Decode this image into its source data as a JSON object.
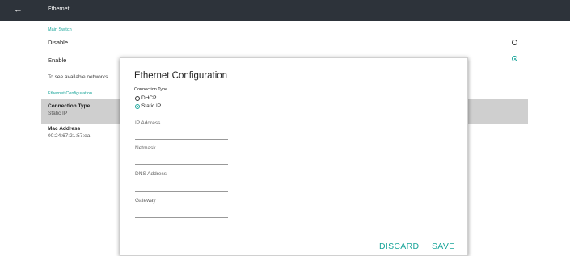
{
  "topbar": {
    "back_icon": "arrow-left-icon",
    "title": "Ethernet"
  },
  "settings": {
    "main_switch": {
      "section_label": "Main Switch",
      "options": [
        {
          "label": "Disable",
          "selected": false
        },
        {
          "label": "Enable",
          "selected": true
        }
      ]
    },
    "hint": "To see available networks",
    "ethernet_config": {
      "section_label": "Ethernet Configuration",
      "connection_type": {
        "title": "Connection Type",
        "value": "Static IP"
      },
      "mac_address": {
        "title": "Mac Address",
        "value": "00:24:67:21:57:ea"
      }
    }
  },
  "dialog": {
    "title": "Ethernet Configuration",
    "connection_type_label": "Connection Type",
    "options": [
      {
        "label": "DHCP",
        "selected": false
      },
      {
        "label": "Static IP",
        "selected": true
      }
    ],
    "fields": [
      {
        "label": "IP Address",
        "value": ""
      },
      {
        "label": "Netmask",
        "value": ""
      },
      {
        "label": "DNS Address",
        "value": ""
      },
      {
        "label": "Gateway",
        "value": ""
      }
    ],
    "discard_label": "DISCARD",
    "save_label": "SAVE"
  },
  "colors": {
    "accent": "#1aa59a",
    "topbar": "#2d333a",
    "highlight_row": "#cfcfcf"
  }
}
